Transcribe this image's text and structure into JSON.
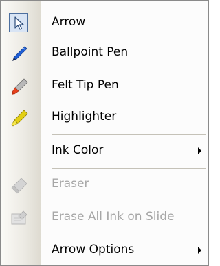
{
  "menu": {
    "items": [
      {
        "label": "Arrow",
        "icon": "arrow-cursor-icon",
        "disabled": false,
        "selected": true
      },
      {
        "label": "Ballpoint Pen",
        "icon": "ballpoint-pen-icon",
        "disabled": false
      },
      {
        "label": "Felt Tip Pen",
        "icon": "felt-tip-pen-icon",
        "disabled": false
      },
      {
        "label": "Highlighter",
        "icon": "highlighter-icon",
        "disabled": false
      },
      {
        "label": "Ink Color",
        "icon": "",
        "disabled": false,
        "submenu": true
      },
      {
        "label": "Eraser",
        "icon": "eraser-icon",
        "disabled": true
      },
      {
        "label": "Erase All Ink on Slide",
        "icon": "erase-all-ink-icon",
        "disabled": true
      },
      {
        "label": "Arrow Options",
        "icon": "",
        "disabled": false,
        "submenu": true
      }
    ]
  },
  "colors": {
    "gutter": "#eceae3",
    "selection": "#d8e4f4",
    "ballpoint": "#1f5fd6",
    "felt_tip": "#e8401c",
    "highlighter": "#e3cf14",
    "disabled_text": "#a6a6a6"
  }
}
